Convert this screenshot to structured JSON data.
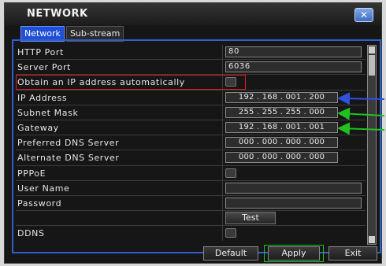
{
  "window": {
    "title": "NETWORK",
    "close_label": "✕"
  },
  "tabs": [
    {
      "label": "Network"
    },
    {
      "label": "Sub-stream"
    }
  ],
  "rows": {
    "http_port": {
      "label": "HTTP Port",
      "value": "80"
    },
    "server_port": {
      "label": "Server Port",
      "value": "6036"
    },
    "dhcp": {
      "label": "Obtain an IP address automatically"
    },
    "ip_address": {
      "label": "IP Address",
      "value": "192 . 168 . 001 . 200"
    },
    "subnet_mask": {
      "label": "Subnet Mask",
      "value": "255 . 255 . 255 . 000"
    },
    "gateway": {
      "label": "Gateway",
      "value": "192 . 168 . 001 . 001"
    },
    "pref_dns": {
      "label": "Preferred DNS Server",
      "value": "000 . 000 . 000 . 000"
    },
    "alt_dns": {
      "label": "Alternate DNS Server",
      "value": "000 . 000 . 000 . 000"
    },
    "pppoe": {
      "label": "PPPoE"
    },
    "user_name": {
      "label": "User Name",
      "value": ""
    },
    "password": {
      "label": "Password",
      "value": ""
    },
    "test": {
      "label": "Test"
    },
    "ddns": {
      "label": "DDNS"
    }
  },
  "buttons": {
    "default": "Default",
    "apply": "Apply",
    "exit": "Exit"
  },
  "colors": {
    "accent": "#2f5fd0",
    "highlight_red": "#e01c1c",
    "highlight_green": "#18c418",
    "arrow_blue": "#3050e0",
    "arrow_green": "#20c020"
  },
  "icons": {
    "close": "close-icon",
    "scroll_up": "scroll-up-icon",
    "scroll_down": "scroll-down-icon"
  }
}
